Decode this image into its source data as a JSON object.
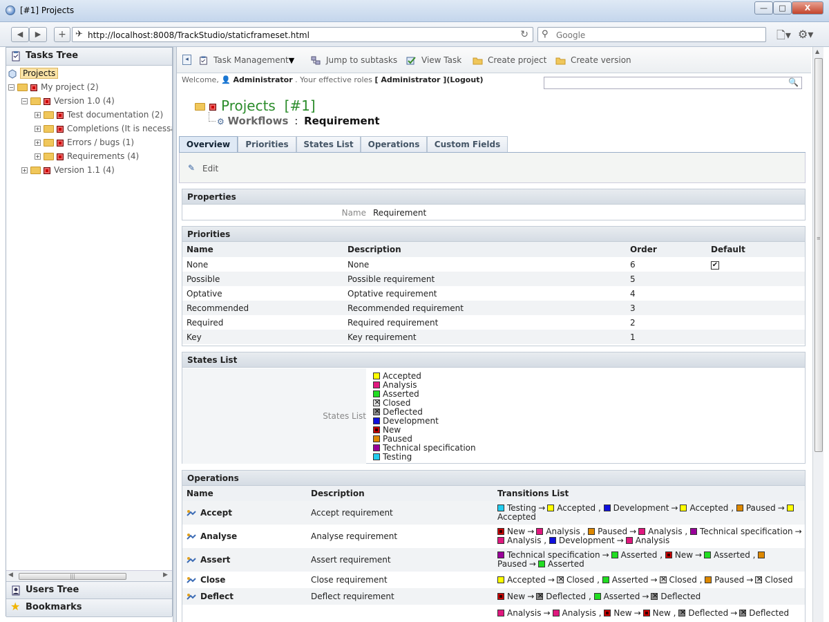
{
  "window": {
    "title": "[#1] Projects",
    "buttons": {
      "minimize": "—",
      "maximize": "□",
      "close": "X"
    }
  },
  "browser": {
    "url": "http://localhost:8008/TrackStudio/staticframeset.html",
    "search_placeholder": "Google"
  },
  "left": {
    "tasks_tree_label": "Tasks Tree",
    "users_tree_label": "Users Tree",
    "bookmarks_label": "Bookmarks",
    "tree": [
      {
        "label": "Projects",
        "level": 0
      },
      {
        "label": "My project (2)",
        "level": 1
      },
      {
        "label": "Version 1.0 (4)",
        "level": 2
      },
      {
        "label": "Test documentation (2)",
        "level": 3
      },
      {
        "label": "Completions (It is necessary",
        "level": 3
      },
      {
        "label": "Errors / bugs (1)",
        "level": 3
      },
      {
        "label": "Requirements (4)",
        "level": 3
      },
      {
        "label": "Version 1.1 (4)",
        "level": 2
      }
    ]
  },
  "toolbar": {
    "task_management": "Task Management",
    "jump_to_subtasks": "Jump to subtasks",
    "view_task": "View Task",
    "create_project": "Create project",
    "create_version": "Create version"
  },
  "welcome": {
    "prefix": "Welcome,",
    "user": "Administrator",
    "roles_text": ". Your effective roles",
    "roles": "[ Administrator ]",
    "logout": "(Logout)"
  },
  "page": {
    "title": "Projects  [#1]",
    "workflows": "Workflows",
    "separator": ":",
    "workflow_name": "Requirement"
  },
  "tabs": [
    "Overview",
    "Priorities",
    "States List",
    "Operations",
    "Custom Fields"
  ],
  "edit_label": "Edit",
  "properties": {
    "header": "Properties",
    "name_label": "Name",
    "name_value": "Requirement"
  },
  "priorities": {
    "header": "Priorities",
    "columns": [
      "Name",
      "Description",
      "Order",
      "Default"
    ],
    "rows": [
      {
        "name": "None",
        "description": "None",
        "order": "6",
        "default": "✔"
      },
      {
        "name": "Possible",
        "description": "Possible requirement",
        "order": "5",
        "default": ""
      },
      {
        "name": "Optative",
        "description": "Optative requirement",
        "order": "4",
        "default": ""
      },
      {
        "name": "Recommended",
        "description": "Recommended requirement",
        "order": "3",
        "default": ""
      },
      {
        "name": "Required",
        "description": "Required requirement",
        "order": "2",
        "default": ""
      },
      {
        "name": "Key",
        "description": "Key requirement",
        "order": "1",
        "default": ""
      }
    ]
  },
  "states": {
    "header": "States List",
    "label": "States List",
    "items": [
      {
        "name": "Accepted",
        "color": "#ffff00"
      },
      {
        "name": "Analysis",
        "color": "#e0187e"
      },
      {
        "name": "Asserted",
        "color": "#22dd22"
      },
      {
        "name": "Closed",
        "color": "#dddddd"
      },
      {
        "name": "Deflected",
        "color": "#888888"
      },
      {
        "name": "Development",
        "color": "#1010dd"
      },
      {
        "name": "New",
        "color": "#cc0000"
      },
      {
        "name": "Paused",
        "color": "#dd8800"
      },
      {
        "name": "Technical specification",
        "color": "#990099"
      },
      {
        "name": "Testing",
        "color": "#22ccee"
      }
    ]
  },
  "operations": {
    "header": "Operations",
    "columns": [
      "Name",
      "Description",
      "Transitions List"
    ],
    "rows": [
      {
        "name": "Accept",
        "description": "Accept requirement",
        "transitions": [
          [
            "Testing",
            "Accepted"
          ],
          [
            "Development",
            "Accepted"
          ],
          [
            "Paused",
            "Accepted"
          ]
        ]
      },
      {
        "name": "Analyse",
        "description": "Analyse requirement",
        "transitions": [
          [
            "New",
            "Analysis"
          ],
          [
            "Paused",
            "Analysis"
          ],
          [
            "Technical specification",
            "Analysis"
          ],
          [
            "Development",
            "Analysis"
          ]
        ]
      },
      {
        "name": "Assert",
        "description": "Assert requirement",
        "transitions": [
          [
            "Technical specification",
            "Asserted"
          ],
          [
            "New",
            "Asserted"
          ],
          [
            "Paused",
            "Asserted"
          ]
        ]
      },
      {
        "name": "Close",
        "description": "Close requirement",
        "transitions": [
          [
            "Accepted",
            "Closed"
          ],
          [
            "Asserted",
            "Closed"
          ],
          [
            "Paused",
            "Closed"
          ]
        ]
      },
      {
        "name": "Deflect",
        "description": "Deflect requirement",
        "transitions": [
          [
            "New",
            "Deflected"
          ],
          [
            "Asserted",
            "Deflected"
          ]
        ]
      },
      {
        "name": "",
        "description": "",
        "transitions": [
          [
            "Analysis",
            "Analysis"
          ],
          [
            "New",
            "New"
          ],
          [
            "Deflected",
            "Deflected"
          ]
        ]
      }
    ]
  }
}
